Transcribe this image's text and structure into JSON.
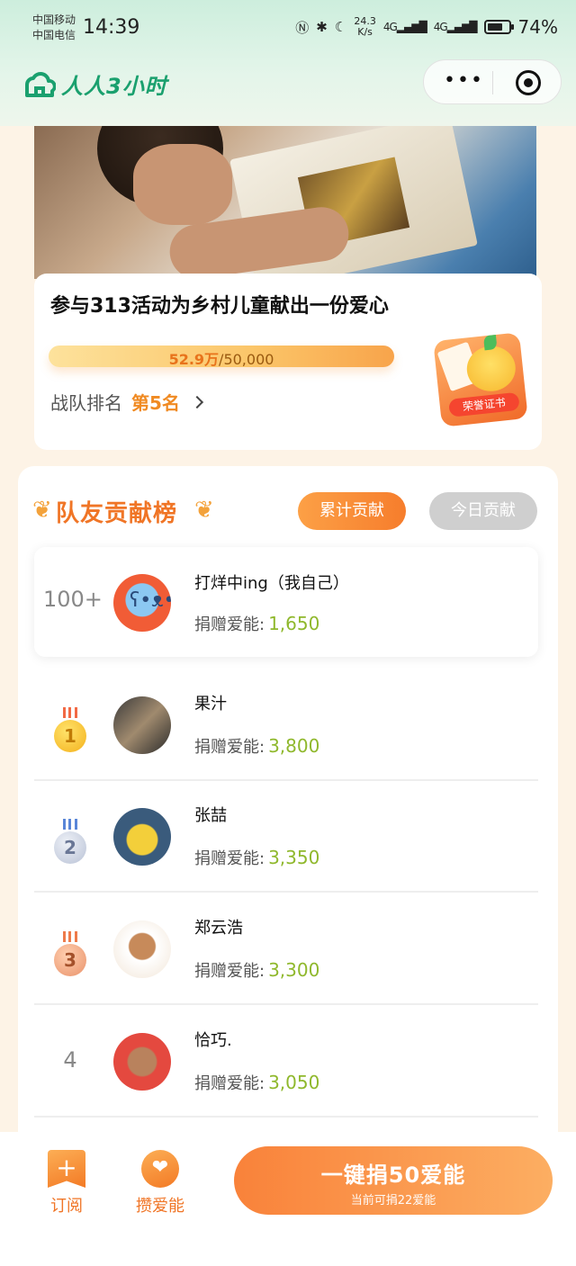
{
  "status_bar": {
    "carrier_1": "中国移动",
    "carrier_2": "中国电信",
    "time": "14:39",
    "net_speed_value": "24.3",
    "net_speed_unit": "K/s",
    "signal_1": "4G",
    "signal_2": "4G",
    "battery_pct": "74%",
    "battery_level": 0.74
  },
  "app": {
    "logo_text": "人人3小时",
    "brand_color": "#1aa06e",
    "capsule_more": "•••"
  },
  "activity": {
    "title": "参与313活动为乡村儿童献出一份爱心",
    "progress_current": "52.9万",
    "progress_target": "/50,000",
    "rank_label": "战队排名",
    "rank_value": "第5名",
    "certificate_label": "荣誉证书"
  },
  "board": {
    "title": "队友贡献榜",
    "laurel_left": "❦",
    "laurel_right": "❦",
    "tabs": [
      {
        "label": "累计贡献",
        "active": true
      },
      {
        "label": "今日贡献",
        "active": false
      }
    ],
    "donate_label": "捐赠爱能:",
    "me": {
      "rank": "100+",
      "name": "打烊中ing（我自己）",
      "value": "1,650"
    },
    "entries": [
      {
        "rank": "1",
        "name": "果汁",
        "value": "3,800"
      },
      {
        "rank": "2",
        "name": "张喆",
        "value": "3,350"
      },
      {
        "rank": "3",
        "name": "郑云浩",
        "value": "3,300"
      },
      {
        "rank": "4",
        "name": "恰巧.",
        "value": "3,050"
      }
    ]
  },
  "bottom_bar": {
    "subscribe_label": "订阅",
    "subscribe_icon": "plus-bookmark-icon",
    "collect_label": "攒爱能",
    "collect_icon": "heart-icon",
    "donate_main": "一键捐50爱能",
    "donate_sub": "当前可捐22爱能",
    "accent": "#f37a25"
  }
}
